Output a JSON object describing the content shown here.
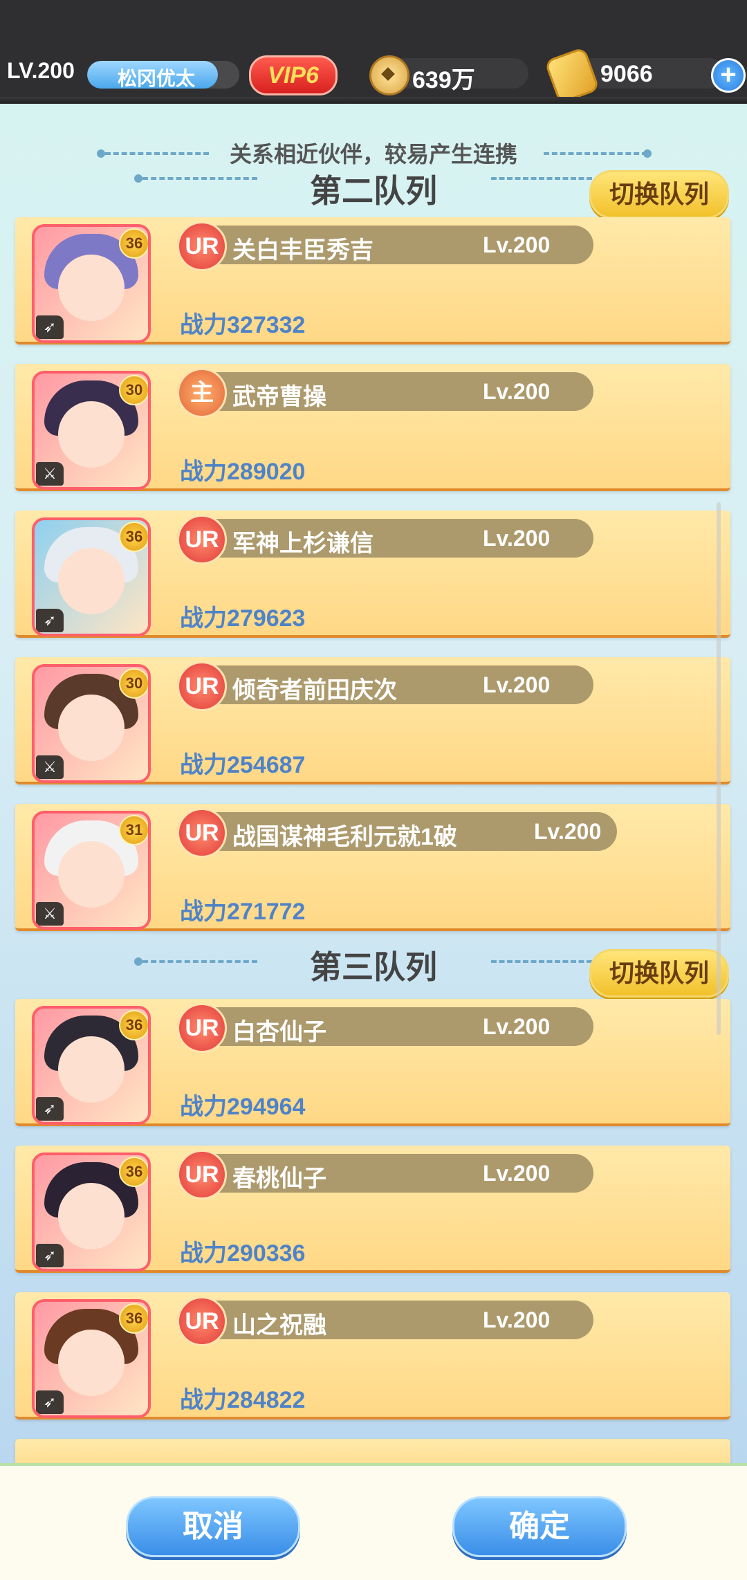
{
  "header": {
    "level": "LV.200",
    "player_name": "松冈优太",
    "vip": "VIP6",
    "copper": "639万",
    "gold": "9066",
    "add_icon": "plus-icon"
  },
  "hint": "关系相近伙伴，较易产生连携",
  "sections": [
    {
      "title": "第二队列",
      "switch_label": "切换队列"
    },
    {
      "title": "第三队列",
      "switch_label": "切换队列"
    }
  ],
  "cards": [
    {
      "rarity": "UR",
      "name": "关白丰臣秀吉",
      "lv": "Lv.200",
      "power": "战力327332",
      "star": "36",
      "hair": "#7e79c6"
    },
    {
      "rarity": "主",
      "name": "武帝曹操",
      "lv": "Lv.200",
      "power": "战力289020",
      "star": "30",
      "hair": "#3a2e4f"
    },
    {
      "rarity": "UR",
      "name": "军神上杉谦信",
      "lv": "Lv.200",
      "power": "战力279623",
      "star": "36",
      "hair": "#e6ecf2"
    },
    {
      "rarity": "UR",
      "name": "倾奇者前田庆次",
      "lv": "Lv.200",
      "power": "战力254687",
      "star": "30",
      "hair": "#5a3a2a"
    },
    {
      "rarity": "UR",
      "name": "战国谋神毛利元就1破",
      "lv": "Lv.200",
      "power": "战力271772",
      "star": "31",
      "hair": "#f2f2f2"
    },
    {
      "rarity": "UR",
      "name": "白杏仙子",
      "lv": "Lv.200",
      "power": "战力294964",
      "star": "36",
      "hair": "#2d2a36"
    },
    {
      "rarity": "UR",
      "name": "春桃仙子",
      "lv": "Lv.200",
      "power": "战力290336",
      "star": "36",
      "hair": "#2b2233"
    },
    {
      "rarity": "UR",
      "name": "山之祝融",
      "lv": "Lv.200",
      "power": "战力284822",
      "star": "36",
      "hair": "#6a3b22"
    }
  ],
  "footer": {
    "cancel": "取消",
    "confirm": "确定"
  }
}
